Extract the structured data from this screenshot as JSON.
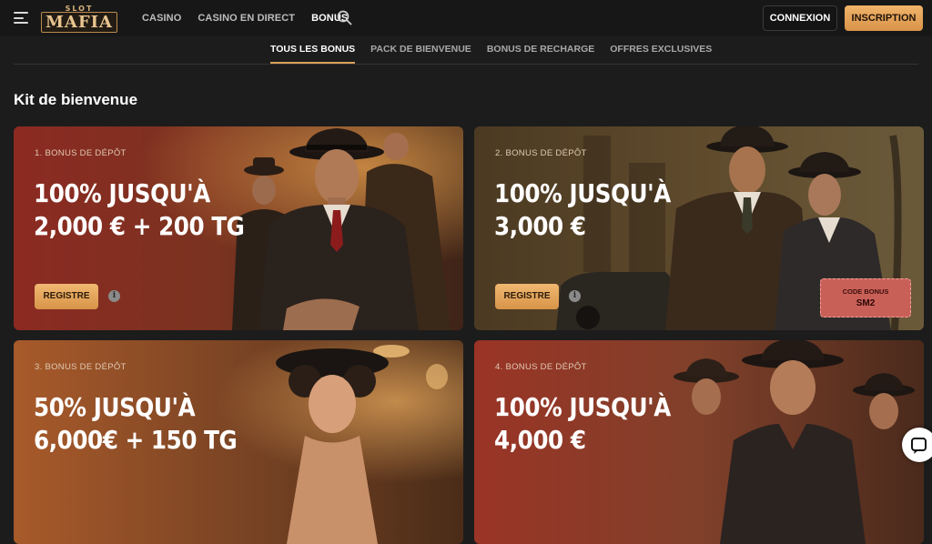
{
  "header": {
    "logo_top": "SLOT",
    "logo_main": "MAFIA",
    "nav": [
      "CASINO",
      "CASINO EN DIRECT",
      "BONUS"
    ],
    "active_nav": "BONUS",
    "login_label": "CONNEXION",
    "signup_label": "INSCRIPTION",
    "accent_color": "#e0a15c"
  },
  "subtabs": [
    "TOUS LES BONUS",
    "PACK DE BIENVENUE",
    "BONUS DE RECHARGE",
    "OFFRES EXCLUSIVES"
  ],
  "section_title": "Kit de bienvenue",
  "cards": [
    {
      "label": "1. BONUS DE DÉPÔT",
      "line1": "100% JUSQU'À",
      "line2": "2,000 € + 200 TG",
      "button": "REGISTRE",
      "info": "i"
    },
    {
      "label": "2. BONUS DE DÉPÔT",
      "line1": "100% JUSQU'À",
      "line2": "3,000 €",
      "button": "REGISTRE",
      "info": "i",
      "promo_label": "CODE BONUS",
      "promo_code": "SM2"
    },
    {
      "label": "3. BONUS DE DÉPÔT",
      "line1": "50% JUSQU'À",
      "line2": "6,000€ + 150 TG"
    },
    {
      "label": "4. BONUS DE DÉPÔT",
      "line1": "100% JUSQU'À",
      "line2": "4,000 €"
    }
  ]
}
